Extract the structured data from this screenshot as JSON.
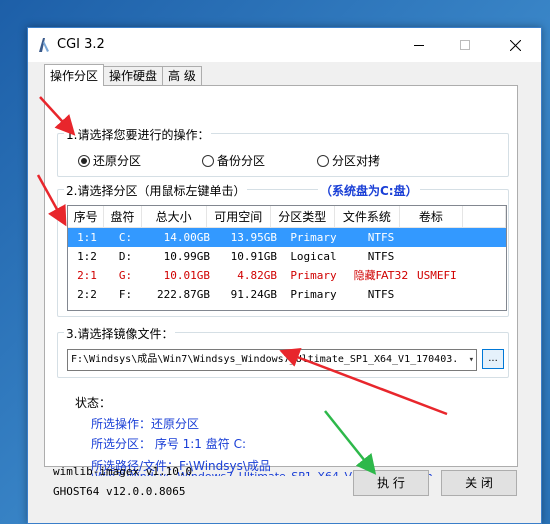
{
  "window": {
    "title": "CGI 3.2"
  },
  "tabs": [
    {
      "label": "操作分区",
      "active": true
    },
    {
      "label": "操作硬盘",
      "active": false
    },
    {
      "label": "高 级",
      "active": false
    }
  ],
  "step1": {
    "title": "1.请选择您要进行的操作：",
    "options": [
      {
        "label": "还原分区",
        "checked": true
      },
      {
        "label": "备份分区",
        "checked": false
      },
      {
        "label": "分区对拷",
        "checked": false
      }
    ]
  },
  "step2": {
    "title": "2.请选择分区（用鼠标左键单击）",
    "system_disk": "（系统盘为C:盘）",
    "columns": [
      "序号",
      "盘符",
      "总大小",
      "可用空间",
      "分区类型",
      "文件系统",
      "卷标"
    ],
    "rows": [
      {
        "index": "1:1",
        "drive": "C:",
        "total": "14.00GB",
        "free": "13.95GB",
        "type": "Primary",
        "fs": "NTFS",
        "label": "",
        "selected": true,
        "hidden": false
      },
      {
        "index": "1:2",
        "drive": "D:",
        "total": "10.99GB",
        "free": "10.91GB",
        "type": "Logical",
        "fs": "NTFS",
        "label": "",
        "selected": false,
        "hidden": false
      },
      {
        "index": "2:1",
        "drive": "G:",
        "total": "10.01GB",
        "free": "4.82GB",
        "type": "Primary",
        "fs": "隐藏FAT32",
        "label": "USMEFI",
        "selected": false,
        "hidden": true
      },
      {
        "index": "2:2",
        "drive": "F:",
        "total": "222.87GB",
        "free": "91.24GB",
        "type": "Primary",
        "fs": "NTFS",
        "label": "",
        "selected": false,
        "hidden": false
      }
    ]
  },
  "step3": {
    "title": "3.请选择镜像文件：",
    "path_value": "F:\\Windsys\\成品\\Win7\\Windsys_Windows7_Ultimate_SP1_X64_V1_170403.",
    "browse_label": "..."
  },
  "status": {
    "title": "状态：",
    "operation": "所选操作：还原分区",
    "partition": "所选分区：   序号 1:1       盘符 C:",
    "path_label": "所选路径/文件：F:\\Windsys\\成品",
    "path_cont": "\\Win7\\Windsys_Windows7_Ultimate_SP1_X64_V1_170403.wim"
  },
  "footer": {
    "wimlib": "wimlib-imagex v1.10.0",
    "ghost": "GHOST64 v12.0.0.8065"
  },
  "buttons": {
    "execute": "执 行",
    "close": "关 闭"
  },
  "colors": {
    "selected_row": "#3399ff",
    "hidden_partition": "#d00000",
    "status_text": "#1a3fd6",
    "annotation_red": "#e8262c",
    "annotation_green": "#2db84a"
  }
}
